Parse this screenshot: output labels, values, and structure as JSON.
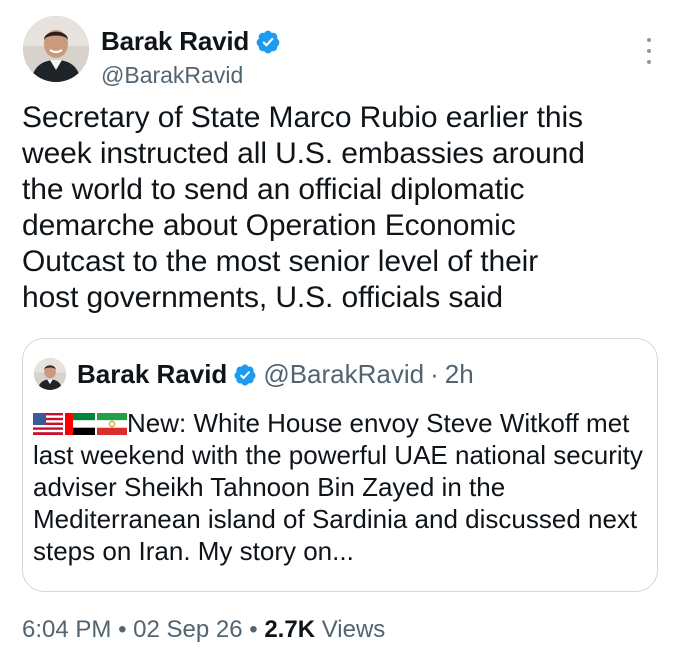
{
  "author": {
    "name": "Barak Ravid",
    "handle": "@BarakRavid"
  },
  "tweet": {
    "text": "Secretary of State Marco Rubio earlier this\nweek instructed all U.S. embassies around\nthe world to send an official diplomatic\ndemarche about Operation Economic\nOutcast to the most senior level of their\nhost governments, U.S. officials said"
  },
  "quote": {
    "name": "Barak Ravid",
    "handle": "@BarakRavid",
    "separator": "·",
    "time": "2h",
    "flags": [
      "us-flag",
      "uae-flag",
      "iran-flag"
    ],
    "text": "New: White House envoy Steve Witkoff met last weekend with the powerful UAE national security adviser Sheikh Tahnoon Bin Zayed in the Mediterranean island of Sardinia and discussed next steps on Iran. My story on..."
  },
  "footer": {
    "time": "6:04 PM",
    "sep1": "•",
    "date": "02 Sep 26",
    "sep2": "•",
    "views_count": "2.7K",
    "views_label": "Views"
  },
  "colors": {
    "text": "#0f1419",
    "secondary": "#536471",
    "verified": "#1d9bf0",
    "border": "#cfd9de"
  }
}
